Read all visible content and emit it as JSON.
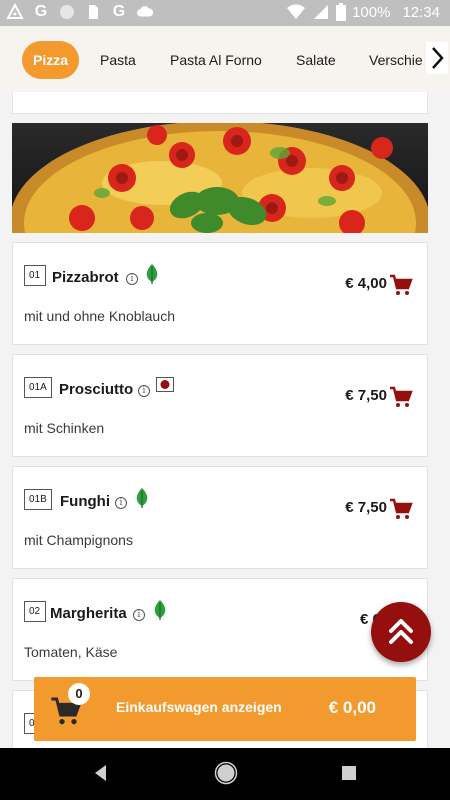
{
  "status_bar": {
    "battery": "100%",
    "time": "12:34",
    "icons": [
      "triangle-icon",
      "google-icon",
      "circle-icon",
      "sim-icon",
      "google-icon",
      "cloud-icon",
      "wifi-icon",
      "signal-icon",
      "battery-icon"
    ]
  },
  "categories": [
    {
      "label": "Pizza",
      "active": true
    },
    {
      "label": "Pasta",
      "active": false
    },
    {
      "label": "Pasta Al Forno",
      "active": false
    },
    {
      "label": "Salate",
      "active": false
    },
    {
      "label": "Verschie",
      "active": false
    }
  ],
  "items": [
    {
      "num": "01",
      "name": "Pizzabrot",
      "badge": "leaf",
      "price": "€ 4,00",
      "desc": "mit und ohne Knoblauch"
    },
    {
      "num": "01A",
      "name": "Prosciutto",
      "badge": "meat",
      "price": "€ 7,50",
      "desc": "mit Schinken"
    },
    {
      "num": "01B",
      "name": "Funghi",
      "badge": "leaf",
      "price": "€ 7,50",
      "desc": "mit Champignons"
    },
    {
      "num": "02",
      "name": "Margherita",
      "badge": "leaf",
      "price": "€ 6,",
      "desc": "Tomaten, Käse"
    },
    {
      "num": "0"
    }
  ],
  "info_symbol": "i",
  "cart": {
    "count": "0",
    "label": "Einkaufswagen anzeigen",
    "total": "€ 0,00"
  },
  "colors": {
    "accent": "#f39a2e",
    "dark_red": "#960f0f",
    "leaf_green": "#2e9e3e"
  }
}
